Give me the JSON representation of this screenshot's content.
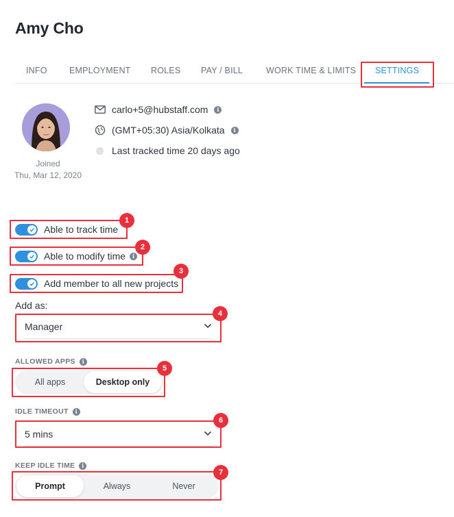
{
  "page": {
    "title": "Amy Cho"
  },
  "tabs": [
    {
      "label": "INFO",
      "active": false
    },
    {
      "label": "EMPLOYMENT",
      "active": false
    },
    {
      "label": "ROLES",
      "active": false
    },
    {
      "label": "PAY / BILL",
      "active": false
    },
    {
      "label": "WORK TIME & LIMITS",
      "active": false
    },
    {
      "label": "SETTINGS",
      "active": true
    }
  ],
  "profile": {
    "joined_label": "Joined",
    "joined_date": "Thu, Mar 12, 2020",
    "email": "carlo+5@hubstaff.com",
    "timezone": "(GMT+05:30) Asia/Kolkata",
    "last_tracked": "Last tracked time 20 days ago"
  },
  "settings": {
    "track_time": {
      "label": "Able to track time",
      "enabled": true
    },
    "modify_time": {
      "label": "Able to modify time",
      "enabled": true
    },
    "add_to_projects": {
      "label": "Add member to all new projects",
      "enabled": true
    },
    "add_as": {
      "label": "Add as:",
      "value": "Manager"
    },
    "allowed_apps": {
      "label": "ALLOWED APPS",
      "options": [
        "All apps",
        "Desktop only"
      ],
      "selected": "Desktop only"
    },
    "idle_timeout": {
      "label": "IDLE TIMEOUT",
      "value": "5 mins"
    },
    "keep_idle_time": {
      "label": "KEEP IDLE TIME",
      "options": [
        "Prompt",
        "Always",
        "Never"
      ],
      "selected": "Prompt"
    }
  },
  "annotations": [
    "1",
    "2",
    "3",
    "4",
    "5",
    "6",
    "7"
  ],
  "colors": {
    "accent": "#2f90dd",
    "highlight": "#e8303c",
    "info_icon": "#7b8390"
  },
  "icons": {
    "info": "i"
  }
}
